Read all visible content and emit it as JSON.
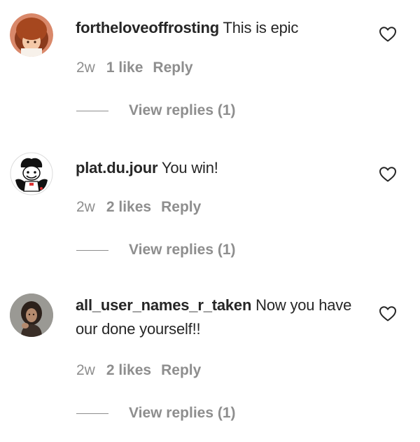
{
  "comments": [
    {
      "username": "fortheloveoffrosting",
      "text": " This is epic",
      "time": "2w",
      "likes": "1 like",
      "reply_label": "Reply",
      "view_replies": "View replies (1)",
      "avatar_icon": "avatar-cartoon-redhead",
      "heart_icon": "heart-outline-icon"
    },
    {
      "username": "plat.du.jour",
      "text": " You win!",
      "time": "2w",
      "likes": "2 likes",
      "reply_label": "Reply",
      "view_replies": "View replies (1)",
      "avatar_icon": "avatar-chef-illustration",
      "heart_icon": "heart-outline-icon"
    },
    {
      "username": "all_user_names_r_taken",
      "text": " Now you have our done yourself!!",
      "time": "2w",
      "likes": "2 likes",
      "reply_label": "Reply",
      "view_replies": "View replies (1)",
      "avatar_icon": "avatar-photo-person",
      "heart_icon": "heart-outline-icon"
    }
  ],
  "colors": {
    "text_primary": "#262626",
    "text_secondary": "#8e8e8e",
    "background": "#ffffff"
  }
}
